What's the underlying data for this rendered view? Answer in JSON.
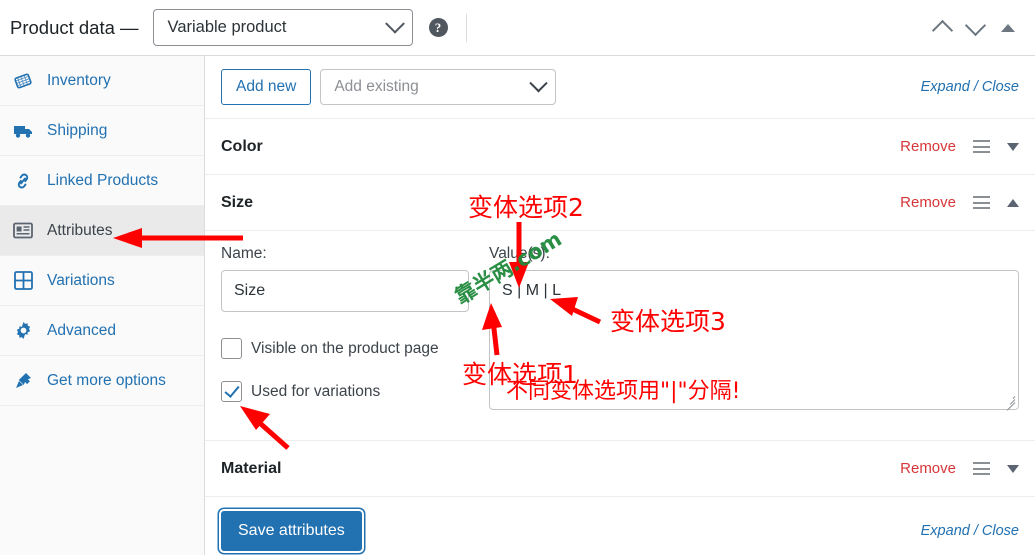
{
  "header": {
    "title": "Product data —",
    "product_type": "Variable product",
    "help_glyph": "?",
    "icons": [
      "chevron-up",
      "chevron-down",
      "triangle-up"
    ]
  },
  "sidebar": {
    "items": [
      {
        "label": "Inventory",
        "icon": "inventory-icon",
        "active": false
      },
      {
        "label": "Shipping",
        "icon": "shipping-truck-icon",
        "active": false
      },
      {
        "label": "Linked Products",
        "icon": "link-icon",
        "active": false
      },
      {
        "label": "Attributes",
        "icon": "attributes-icon",
        "active": true
      },
      {
        "label": "Variations",
        "icon": "grid-icon",
        "active": false
      },
      {
        "label": "Advanced",
        "icon": "gear-icon",
        "active": false
      },
      {
        "label": "Get more options",
        "icon": "plugin-icon",
        "active": false
      }
    ]
  },
  "toolbar": {
    "add_new_label": "Add new",
    "add_existing_placeholder": "Add existing",
    "expand_label": "Expand",
    "separator": " / ",
    "close_label": "Close"
  },
  "attributes": [
    {
      "name": "Color",
      "remove_label": "Remove",
      "expanded": false,
      "toggle": "down"
    },
    {
      "name": "Size",
      "remove_label": "Remove",
      "expanded": true,
      "toggle": "up",
      "detail": {
        "name_label": "Name:",
        "name_value": "Size",
        "values_label": "Value(s):",
        "values_value": "S | M | L",
        "checkbox_visible_label": "Visible on the product page",
        "checkbox_visible_checked": false,
        "checkbox_variations_label": "Used for variations",
        "checkbox_variations_checked": true
      }
    },
    {
      "name": "Material",
      "remove_label": "Remove",
      "expanded": false,
      "toggle": "down"
    }
  ],
  "footer": {
    "save_label": "Save attributes",
    "expand_label": "Expand",
    "separator": " / ",
    "close_label": "Close"
  },
  "annotations": {
    "option2": "变体选项2",
    "option1": "变体选项1",
    "option3": "变体选项3",
    "separator_note": "不同变体选项用\"|\"分隔!",
    "watermark": "靠半两.com"
  },
  "colors": {
    "accent_blue": "#2271b1",
    "annotation_red": "#ff0000",
    "remove_red": "#d63638",
    "watermark_green": "#1f8a3b",
    "active_tab_bg": "#eaeaea"
  }
}
